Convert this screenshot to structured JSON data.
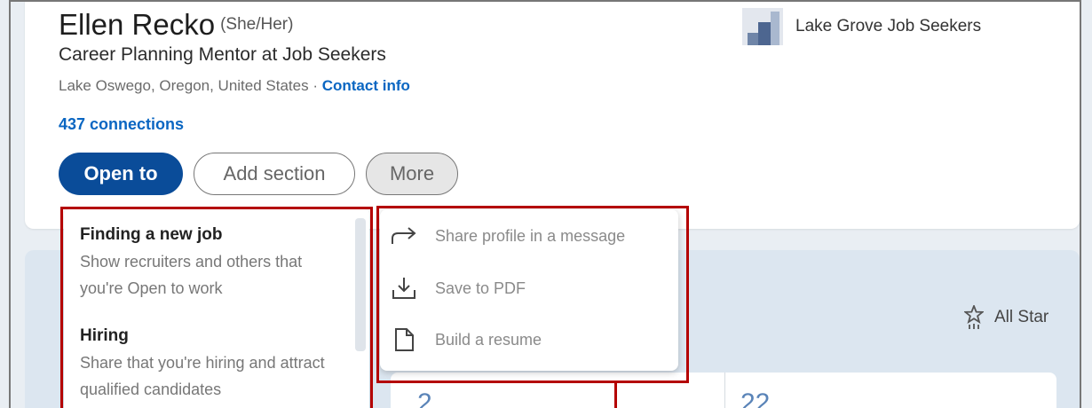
{
  "profile": {
    "name": "Ellen Recko",
    "pronouns": "(She/Her)",
    "headline": "Career Planning Mentor at Job Seekers",
    "location": "Lake Oswego, Oregon, United States",
    "location_separator": " · ",
    "contact_info": "Contact info",
    "connections": "437 connections"
  },
  "company": {
    "name": "Lake Grove Job Seekers",
    "logo_icon": "company-logo-icon"
  },
  "actions": {
    "open_to": "Open to",
    "add_section": "Add section",
    "more": "More"
  },
  "open_to_menu": {
    "items": [
      {
        "title": "Finding a new job",
        "desc_line1": "Show recruiters and others that",
        "desc_line2": "you're Open to work"
      },
      {
        "title": "Hiring",
        "desc_line1": "Share that you're hiring and attract",
        "desc_line2": "qualified candidates"
      }
    ]
  },
  "more_menu": {
    "items": [
      {
        "label": "Share profile in a message",
        "icon": "share-arrow-icon"
      },
      {
        "label": "Save to PDF",
        "icon": "download-icon"
      },
      {
        "label": "Build a resume",
        "icon": "document-icon"
      }
    ]
  },
  "analytics": {
    "all_star": "All Star",
    "all_star_icon": "star-badge-icon",
    "partial_value": "22",
    "partial_value_left": "2"
  },
  "colors": {
    "primary_button": "#0a4c99",
    "link": "#0a66c2",
    "highlight": "#b40000"
  }
}
